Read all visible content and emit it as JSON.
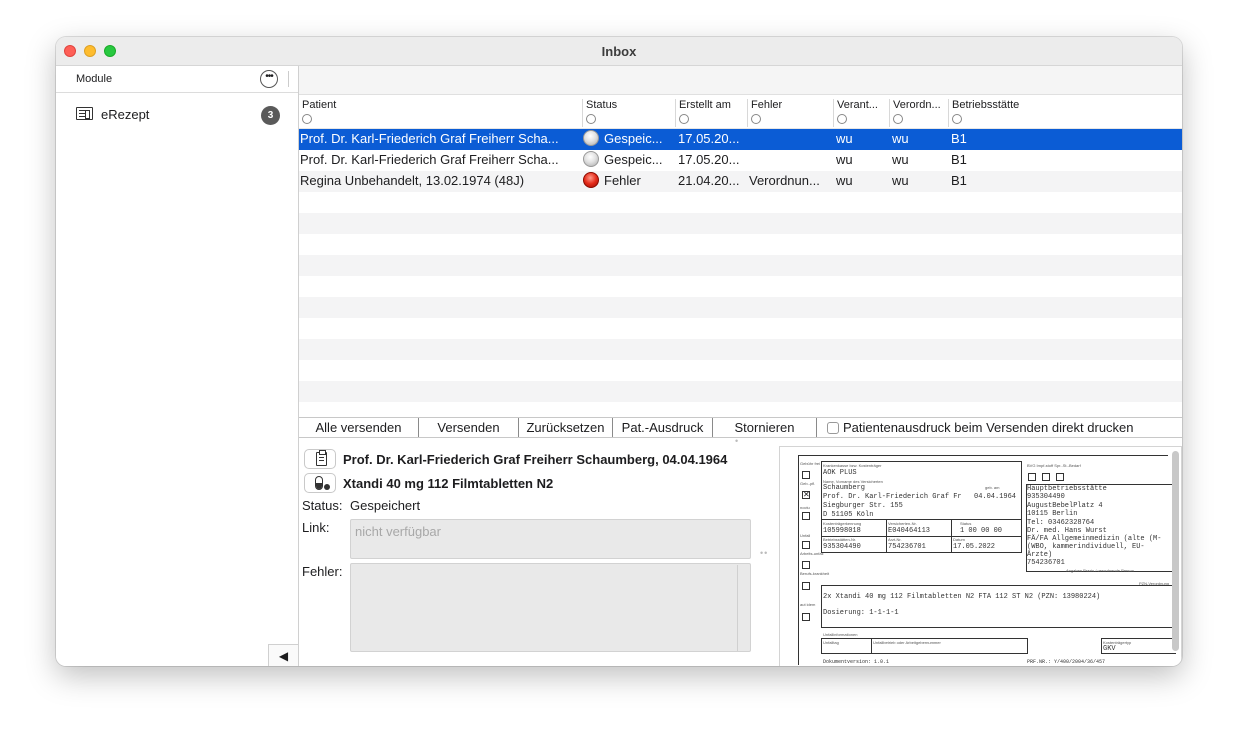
{
  "window": {
    "title": "Inbox"
  },
  "sidebar": {
    "header": "Module",
    "more_icon": "ellipsis-circle-icon",
    "items": [
      {
        "label": "eRezept",
        "icon": "prescription-doc-icon",
        "badge": "3"
      }
    ],
    "collapse_icon": "◀"
  },
  "table": {
    "columns": [
      "Patient",
      "Status",
      "Erstellt am",
      "Fehler",
      "Verant...",
      "Verordn...",
      "Betriebsstätte"
    ],
    "rows": [
      {
        "patient": "Prof. Dr. Karl-Friederich Graf Freiherr Scha...",
        "status": "Gespeic...",
        "status_color": "grey",
        "created": "17.05.20...",
        "error": "",
        "verant": "wu",
        "verordn": "wu",
        "site": "B1",
        "selected": true
      },
      {
        "patient": "Prof. Dr. Karl-Friederich Graf Freiherr Scha...",
        "status": "Gespeic...",
        "status_color": "grey",
        "created": "17.05.20...",
        "error": "",
        "verant": "wu",
        "verordn": "wu",
        "site": "B1",
        "selected": false
      },
      {
        "patient": "Regina Unbehandelt, 13.02.1974 (48J)",
        "status": "Fehler",
        "status_color": "red",
        "created": "21.04.20...",
        "error": "Verordnun...",
        "verant": "wu",
        "verordn": "wu",
        "site": "B1",
        "selected": false
      }
    ]
  },
  "actions": {
    "send_all": "Alle versenden",
    "send": "Versenden",
    "reset": "Zurücksetzen",
    "patient_print": "Pat.-Ausdruck",
    "cancel": "Stornieren",
    "print_checkbox_label": "Patientenausdruck beim Versenden direkt drucken",
    "print_checkbox_checked": false
  },
  "detail": {
    "patient_line": "Prof. Dr. Karl-Friederich Graf Freiherr Schaumberg, 04.04.1964",
    "drug_line": "Xtandi 40 mg 112 Filmtabletten N2",
    "status_label": "Status:",
    "status_value": "Gespeichert",
    "link_label": "Link:",
    "link_placeholder": "nicht verfügbar",
    "error_label": "Fehler:",
    "error_value": ""
  },
  "preview": {
    "left_labels": [
      "Gebühr frei",
      "Geb.-pfl.",
      "noctu",
      "Unfall",
      "Arbeits-unfall",
      "Berufs-krankheit",
      "aut idem"
    ],
    "insurer_label": "Krankenkasse bzw. Kostenträger",
    "insurer": "AOK PLUS",
    "name_label": "Name, Vorname des Versicherten",
    "birth_label": "geb. am",
    "surname": "Schaumberg",
    "fullname": "Prof. Dr. Karl-Friederich Graf Fr",
    "birthdate": "04.04.1964",
    "street": "Siegburger Str. 155",
    "city": "D 51105 Köln",
    "kostentraeger_label": "Kostenträgerkennung",
    "versicherten_label": "Versicherten-Nr.",
    "status_label": "Status",
    "kostentraeger": "105998018",
    "versicherten_nr": "E040464113",
    "status_code": "1 00 00 00",
    "bsnr_label": "Betriebsstätten-Nr.",
    "lanr_label": "Arzt-Nr.",
    "date_label": "Datum",
    "bsnr": "935304490",
    "lanr": "754236701",
    "date": "17.05.2022",
    "top_right_labels": "BVG   Impf-stoff   Spr.-St.-Bedarf",
    "practice": [
      "Hauptbetriebsstätte",
      "935304490",
      "AugustBebelPlatz  4",
      "10115 Berlin",
      "Tel: 03462328764",
      "Dr. med. Hans Wurst",
      "FÄ/FA Allgemeinmedizin (alte (M-",
      "(WBO, kammerindividuell, EU-",
      "Ärzte)",
      "754236701"
    ],
    "practice_footer": "Angaben Praxis / verordnende Person",
    "pzn_label": "PZN-Verordnung",
    "prescription": "2x Xtandi 40 mg 112 Filmtabletten N2 FTA 112 ST N2 (PZN: 13980224)",
    "dosage": "Dosierung: 1-1-1-1",
    "accident_header": "Unfallinformationen",
    "accident_day": "Unfalltag",
    "accident_company": "Unfallbetrieb oder Arbeitgebernummer",
    "cost_type_label": "Kostenträgertyp",
    "cost_type": "GKV",
    "footer_left": "Dokumentversion: 1.0.1",
    "footer_right": "PRF.NR.: Y/400/2004/36/457"
  }
}
